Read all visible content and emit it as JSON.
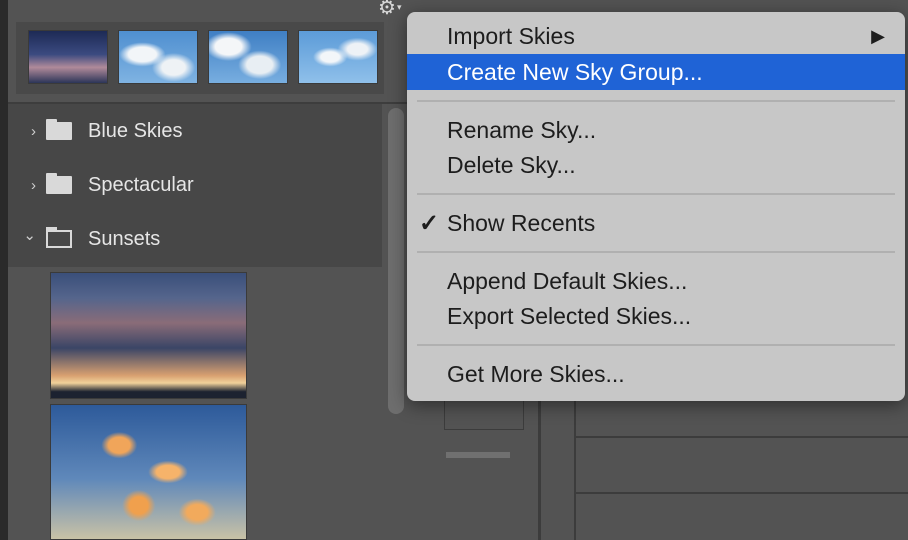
{
  "panel": {
    "gear_label": "⚙",
    "gear_chevron": "▾",
    "folders": [
      {
        "name": "Blue Skies",
        "expanded": false
      },
      {
        "name": "Spectacular",
        "expanded": false
      },
      {
        "name": "Sunsets",
        "expanded": true
      }
    ],
    "chev_collapsed": "›",
    "chev_expanded": "⌄"
  },
  "menu": {
    "import_skies": "Import Skies",
    "submenu_arrow": "▶",
    "create_new_sky_group": "Create New Sky Group...",
    "rename_sky": "Rename Sky...",
    "delete_sky": "Delete Sky...",
    "check_mark": "✓",
    "show_recents": "Show Recents",
    "append_default_skies": "Append Default Skies...",
    "export_selected_skies": "Export Selected Skies...",
    "get_more_skies": "Get More Skies..."
  },
  "colors": {
    "menu_bg": "#c7c7c7",
    "highlight": "#1f63d6",
    "panel_bg": "#535353"
  }
}
